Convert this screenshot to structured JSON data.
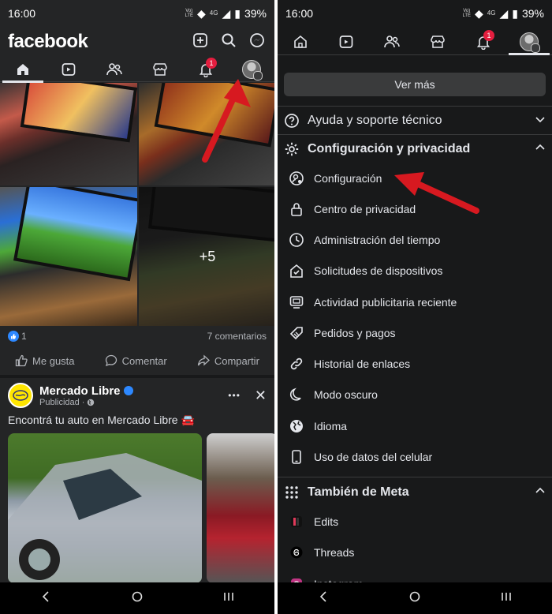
{
  "status_bar": {
    "time": "16:00",
    "network": "4G",
    "volte_top": "Vo)",
    "volte_bottom": "LTE",
    "battery": "39%"
  },
  "left": {
    "app_title": "facebook",
    "notification_badge": "1",
    "photo_overlay": "+5",
    "reactions": {
      "like_count": "1",
      "comments": "7 comentarios"
    },
    "actions": {
      "like": "Me gusta",
      "comment": "Comentar",
      "share": "Compartir"
    },
    "ad": {
      "name": "Mercado Libre",
      "subtitle": "Publicidad",
      "text": "Encontrá tu auto en Mercado Libre 🚘",
      "more": "•••",
      "close": "✕"
    }
  },
  "right": {
    "notification_badge": "1",
    "see_more": "Ver más",
    "help": "Ayuda y soporte técnico",
    "settings_section": "Configuración y privacidad",
    "settings_items": [
      {
        "label": "Configuración",
        "icon": "gear-person-icon"
      },
      {
        "label": "Centro de privacidad",
        "icon": "lock-icon"
      },
      {
        "label": "Administración del tiempo",
        "icon": "clock-icon"
      },
      {
        "label": "Solicitudes de dispositivos",
        "icon": "house-check-icon"
      },
      {
        "label": "Actividad publicitaria reciente",
        "icon": "ad-screen-icon"
      },
      {
        "label": "Pedidos y pagos",
        "icon": "tag-icon"
      },
      {
        "label": "Historial de enlaces",
        "icon": "link-icon"
      },
      {
        "label": "Modo oscuro",
        "icon": "moon-icon"
      },
      {
        "label": "Idioma",
        "icon": "globe-icon"
      },
      {
        "label": "Uso de datos del celular",
        "icon": "phone-icon"
      }
    ],
    "meta_section": "También de Meta",
    "meta_items": [
      {
        "label": "Edits",
        "icon": "edits-icon"
      },
      {
        "label": "Threads",
        "icon": "threads-icon"
      },
      {
        "label": "Instagram",
        "icon": "instagram-icon"
      }
    ]
  },
  "colors": {
    "background": "#242526",
    "menu_background": "#18191a",
    "accent": "#2d88ff",
    "badge": "#e41e3f",
    "annotation_arrow": "#d71920",
    "brand_ml": "#ffe600"
  }
}
